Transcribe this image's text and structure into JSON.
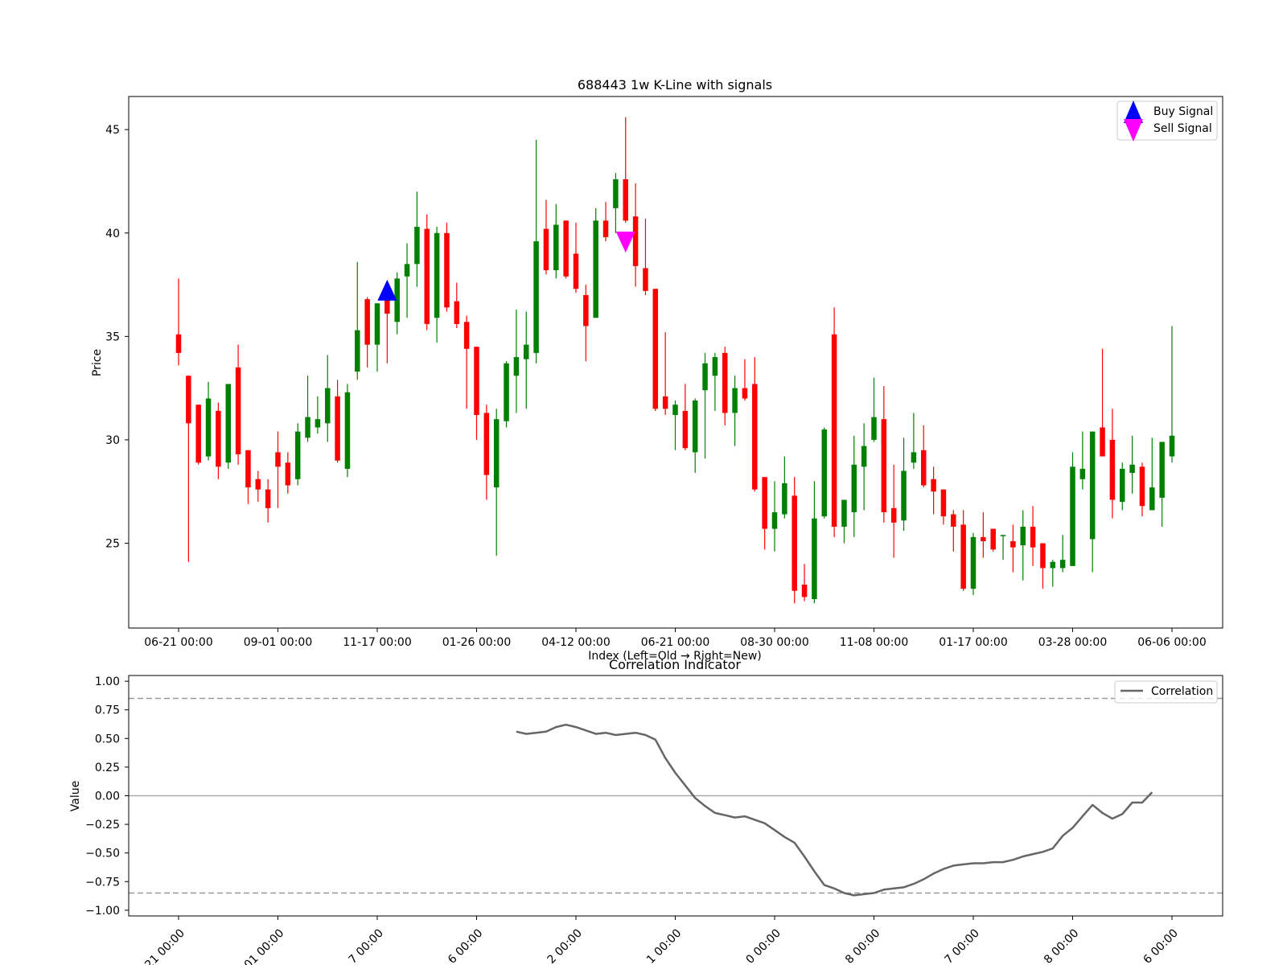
{
  "colors": {
    "up": "#008000",
    "down": "#ff0000",
    "buy": "#0000ff",
    "sell": "#ff00ff",
    "correlation": "#666666",
    "threshold": "#999999",
    "zero_line": "#aaaaaa"
  },
  "chart_data": [
    {
      "type": "candlestick",
      "title": "688443 1w K-Line with signals",
      "xlabel": "Index (Left=Old → Right=New)",
      "ylabel": "Price",
      "ylim": [
        20.9,
        46.6
      ],
      "yticks": [
        25,
        30,
        35,
        40,
        45
      ],
      "xticks": [
        {
          "index": 0,
          "label": "06-21 00:00"
        },
        {
          "index": 10,
          "label": "09-01 00:00"
        },
        {
          "index": 20,
          "label": "11-17 00:00"
        },
        {
          "index": 30,
          "label": "01-26 00:00"
        },
        {
          "index": 40,
          "label": "04-12 00:00"
        },
        {
          "index": 50,
          "label": "06-21 00:00"
        },
        {
          "index": 60,
          "label": "08-30 00:00"
        },
        {
          "index": 70,
          "label": "11-08 00:00"
        },
        {
          "index": 80,
          "label": "01-17 00:00"
        },
        {
          "index": 90,
          "label": "03-28 00:00"
        },
        {
          "index": 100,
          "label": "06-06 00:00"
        }
      ],
      "legend": {
        "position": "top-right",
        "buy_label": "Buy Signal",
        "sell_label": "Sell Signal"
      },
      "candles": [
        [
          35.1,
          34.2,
          37.8,
          33.6
        ],
        [
          33.1,
          30.8,
          33.1,
          24.1
        ],
        [
          31.7,
          28.9,
          31.7,
          28.8
        ],
        [
          29.2,
          32.0,
          32.8,
          29.0
        ],
        [
          31.4,
          28.7,
          31.8,
          28.1
        ],
        [
          28.9,
          32.7,
          32.7,
          28.6
        ],
        [
          33.5,
          29.3,
          34.6,
          28.8
        ],
        [
          29.5,
          27.7,
          29.5,
          26.9
        ],
        [
          28.1,
          27.6,
          28.5,
          27.0
        ],
        [
          27.6,
          26.7,
          28.1,
          26.0
        ],
        [
          29.4,
          28.7,
          30.4,
          26.7
        ],
        [
          28.9,
          27.8,
          29.4,
          27.4
        ],
        [
          28.1,
          30.4,
          30.8,
          27.8
        ],
        [
          30.1,
          31.1,
          33.1,
          29.9
        ],
        [
          30.6,
          31.0,
          32.1,
          30.3
        ],
        [
          30.8,
          32.5,
          34.1,
          29.9
        ],
        [
          32.1,
          29.0,
          32.9,
          28.9
        ],
        [
          28.6,
          32.3,
          32.7,
          28.2
        ],
        [
          33.3,
          35.3,
          38.6,
          32.9
        ],
        [
          36.8,
          34.6,
          36.9,
          33.5
        ],
        [
          34.6,
          36.6,
          36.6,
          33.3
        ],
        [
          37.0,
          36.1,
          37.3,
          33.7
        ],
        [
          35.7,
          37.8,
          38.1,
          35.1
        ],
        [
          37.9,
          38.5,
          39.5,
          35.9
        ],
        [
          38.5,
          40.3,
          42.0,
          37.4
        ],
        [
          40.2,
          35.6,
          40.9,
          35.3
        ],
        [
          35.9,
          40.0,
          40.3,
          34.7
        ],
        [
          40.0,
          36.4,
          40.5,
          36.2
        ],
        [
          36.7,
          35.6,
          37.6,
          35.4
        ],
        [
          35.7,
          34.4,
          36.0,
          31.5
        ],
        [
          34.5,
          31.2,
          34.5,
          30.0
        ],
        [
          31.3,
          28.3,
          31.7,
          27.1
        ],
        [
          27.7,
          31.0,
          31.5,
          24.4
        ],
        [
          30.9,
          33.7,
          33.8,
          30.6
        ],
        [
          33.1,
          34.0,
          36.3,
          31.3
        ],
        [
          33.9,
          34.6,
          36.2,
          31.5
        ],
        [
          34.2,
          39.6,
          44.5,
          33.7
        ],
        [
          40.2,
          38.2,
          41.6,
          38.0
        ],
        [
          38.2,
          40.4,
          41.4,
          37.8
        ],
        [
          40.6,
          37.9,
          40.6,
          37.8
        ],
        [
          39.0,
          37.3,
          40.5,
          37.1
        ],
        [
          37.0,
          35.5,
          37.5,
          33.8
        ],
        [
          35.9,
          40.6,
          41.2,
          35.9
        ],
        [
          40.6,
          39.8,
          41.5,
          39.6
        ],
        [
          41.2,
          42.6,
          42.9,
          40.0
        ],
        [
          42.6,
          40.6,
          45.6,
          40.5
        ],
        [
          40.8,
          38.4,
          42.4,
          37.4
        ],
        [
          38.3,
          37.2,
          40.7,
          37.0
        ],
        [
          37.3,
          31.5,
          37.3,
          31.4
        ],
        [
          32.1,
          31.5,
          35.2,
          31.2
        ],
        [
          31.2,
          31.7,
          31.9,
          29.5
        ],
        [
          31.4,
          29.6,
          32.7,
          29.5
        ],
        [
          29.4,
          31.9,
          32.0,
          28.4
        ],
        [
          32.4,
          33.7,
          34.2,
          29.1
        ],
        [
          33.1,
          34.0,
          34.2,
          31.4
        ],
        [
          34.2,
          31.3,
          34.5,
          30.7
        ],
        [
          31.3,
          32.5,
          33.1,
          29.7
        ],
        [
          32.5,
          32.0,
          33.9,
          31.9
        ],
        [
          32.7,
          27.6,
          34.0,
          27.5
        ],
        [
          28.2,
          25.7,
          28.2,
          24.7
        ],
        [
          25.7,
          26.5,
          28.0,
          24.6
        ],
        [
          26.4,
          27.9,
          29.2,
          26.2
        ],
        [
          27.3,
          22.7,
          28.2,
          22.1
        ],
        [
          23.0,
          22.4,
          24.0,
          22.2
        ],
        [
          22.3,
          26.2,
          28.0,
          22.1
        ],
        [
          26.3,
          30.5,
          30.6,
          26.2
        ],
        [
          35.1,
          25.8,
          36.4,
          25.3
        ],
        [
          25.8,
          27.1,
          27.1,
          25.0
        ],
        [
          26.5,
          28.8,
          30.2,
          25.3
        ],
        [
          28.7,
          29.7,
          30.8,
          26.6
        ],
        [
          30.0,
          31.1,
          33.0,
          29.9
        ],
        [
          31.0,
          26.5,
          32.6,
          26.0
        ],
        [
          26.7,
          26.0,
          28.8,
          24.3
        ],
        [
          26.1,
          28.5,
          30.1,
          25.6
        ],
        [
          28.9,
          29.4,
          31.3,
          28.6
        ],
        [
          29.5,
          27.8,
          30.7,
          27.7
        ],
        [
          28.1,
          27.5,
          28.7,
          26.4
        ],
        [
          27.6,
          26.3,
          27.6,
          25.9
        ],
        [
          26.4,
          25.8,
          26.6,
          24.6
        ],
        [
          25.9,
          22.8,
          26.6,
          22.7
        ],
        [
          22.8,
          25.3,
          25.5,
          22.5
        ],
        [
          25.3,
          25.1,
          26.5,
          24.3
        ],
        [
          25.7,
          24.7,
          25.7,
          24.6
        ],
        [
          25.4,
          25.4,
          25.4,
          24.2
        ],
        [
          25.1,
          24.8,
          25.9,
          23.6
        ],
        [
          24.9,
          25.8,
          26.6,
          23.2
        ],
        [
          25.8,
          24.8,
          26.8,
          23.9
        ],
        [
          25.0,
          23.8,
          25.0,
          22.8
        ],
        [
          23.8,
          24.1,
          24.2,
          22.9
        ],
        [
          23.8,
          24.2,
          25.4,
          23.6
        ],
        [
          23.9,
          28.7,
          29.4,
          23.9
        ],
        [
          28.1,
          28.6,
          30.4,
          27.6
        ],
        [
          25.2,
          30.4,
          30.4,
          23.6
        ],
        [
          30.6,
          29.2,
          34.4,
          29.2
        ],
        [
          30.0,
          27.1,
          31.5,
          26.2
        ],
        [
          27.0,
          28.6,
          28.9,
          26.6
        ],
        [
          28.4,
          28.8,
          30.2,
          27.4
        ],
        [
          28.7,
          26.8,
          28.9,
          26.3
        ],
        [
          26.6,
          27.7,
          30.1,
          26.6
        ],
        [
          27.2,
          29.9,
          29.9,
          25.8
        ],
        [
          29.2,
          30.2,
          35.5,
          28.9
        ]
      ],
      "signals": [
        {
          "type": "buy",
          "index": 21,
          "price": 37.2
        },
        {
          "type": "sell",
          "index": 45,
          "price": 39.6
        }
      ]
    },
    {
      "type": "line",
      "title": "Correlation Indicator",
      "ylabel": "Value",
      "ylim": [
        -1.05,
        1.05
      ],
      "yticks": [
        -1.0,
        -0.75,
        -0.5,
        -0.25,
        0.0,
        0.25,
        0.5,
        0.75,
        1.0
      ],
      "ytick_labels": [
        "−1.00",
        "−0.75",
        "−0.50",
        "−0.25",
        "0.00",
        "0.25",
        "0.50",
        "0.75",
        "1.00"
      ],
      "reference_lines": [
        0.85,
        0.0,
        -0.85
      ],
      "xtick_labels": [
        "21 00:00",
        "01 00:00",
        "7 00:00",
        "6 00:00",
        "2 00:00",
        "1 00:00",
        "0 00:00",
        "8 00:00",
        "7 00:00",
        "8 00:00",
        "6 00:00"
      ],
      "series": [
        {
          "name": "Correlation",
          "start_index": 34,
          "values": [
            0.56,
            0.54,
            0.55,
            0.56,
            0.6,
            0.62,
            0.6,
            0.57,
            0.54,
            0.55,
            0.53,
            0.54,
            0.55,
            0.53,
            0.49,
            0.33,
            0.2,
            0.09,
            -0.02,
            -0.09,
            -0.15,
            -0.17,
            -0.19,
            -0.18,
            -0.21,
            -0.24,
            -0.3,
            -0.36,
            -0.41,
            -0.53,
            -0.66,
            -0.78,
            -0.81,
            -0.85,
            -0.87,
            -0.86,
            -0.85,
            -0.82,
            -0.81,
            -0.8,
            -0.77,
            -0.73,
            -0.68,
            -0.64,
            -0.61,
            -0.6,
            -0.59,
            -0.59,
            -0.58,
            -0.58,
            -0.56,
            -0.53,
            -0.51,
            -0.49,
            -0.46,
            -0.35,
            -0.28,
            -0.18,
            -0.08,
            -0.15,
            -0.2,
            -0.16,
            -0.06,
            -0.06,
            0.03
          ]
        }
      ]
    }
  ]
}
